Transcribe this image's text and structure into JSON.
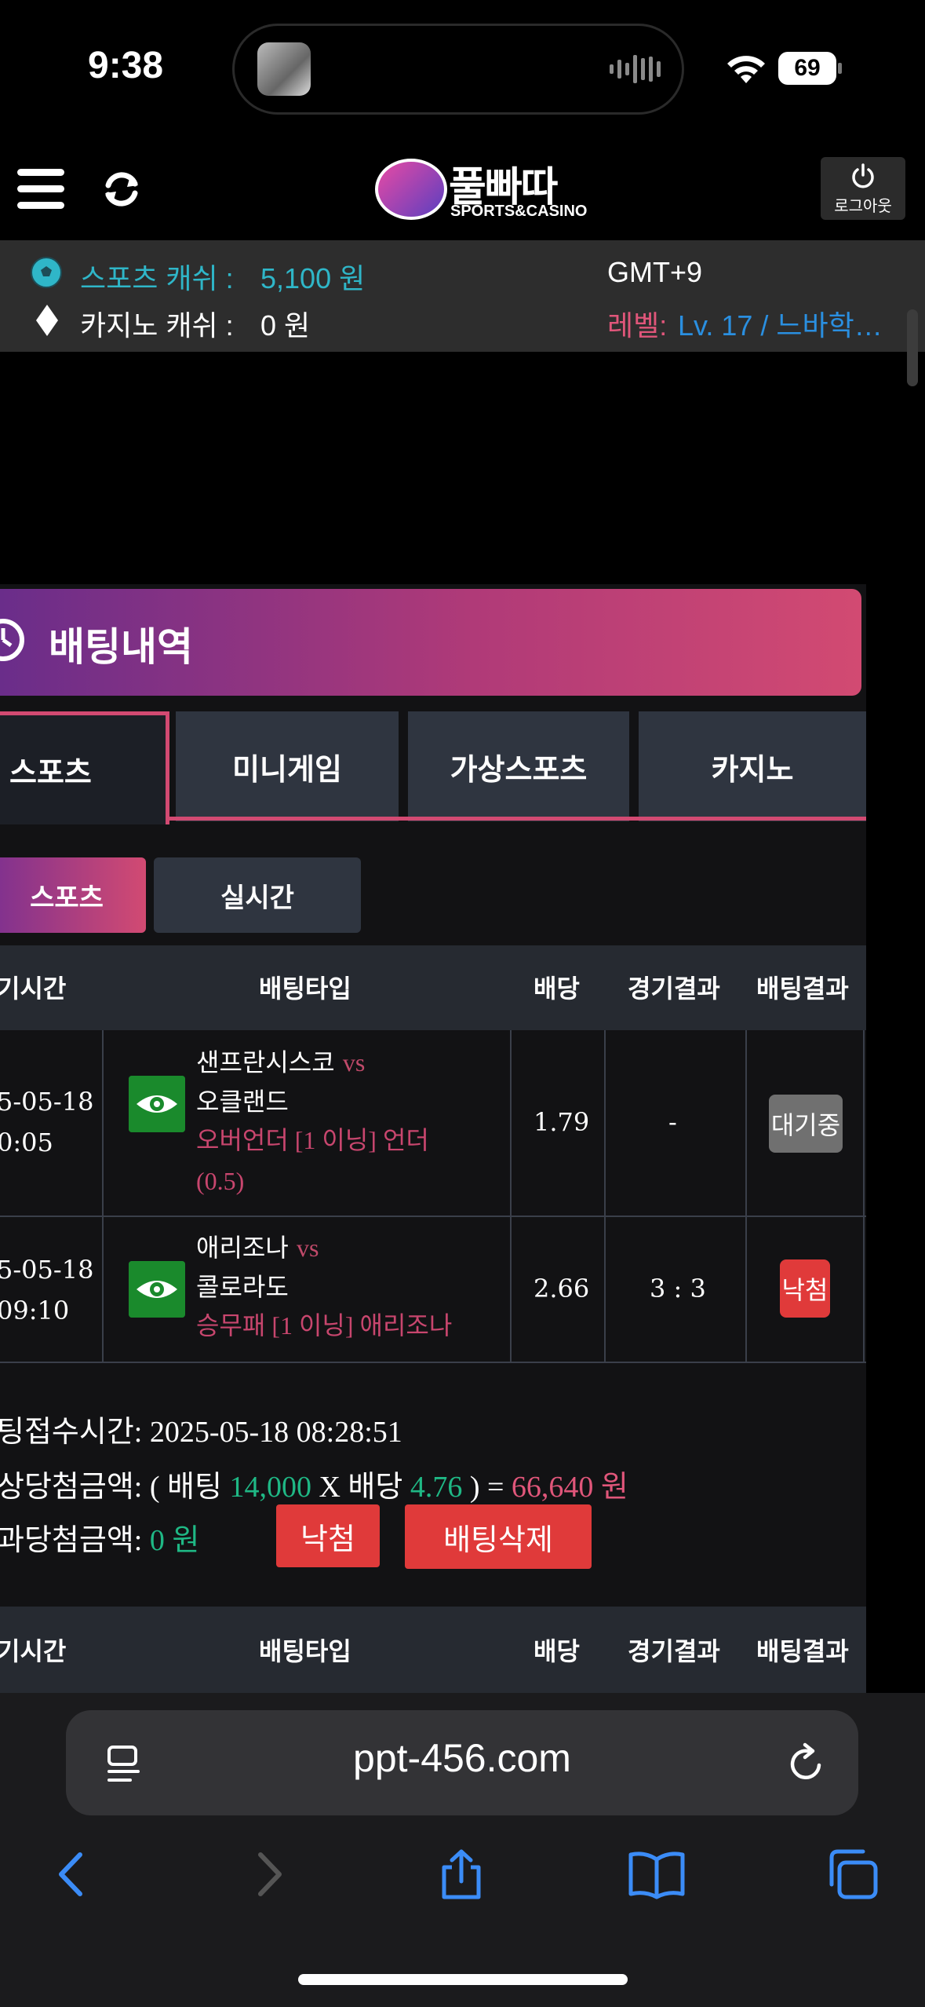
{
  "status": {
    "time": "9:38",
    "battery": "69"
  },
  "header": {
    "logo_text": "풀빠따",
    "logo_sub": "SPORTS&CASINO",
    "logout_label": "로그아웃"
  },
  "info": {
    "sports_cash_label": "스포츠 캐쉬 :",
    "sports_cash_value": "5,100 원",
    "casino_cash_label": "카지노 캐쉬 :",
    "casino_cash_value": "0 원",
    "timezone": "GMT+9",
    "level_label": "레벨:",
    "level_value": "Lv. 17 / 느바학…"
  },
  "section": {
    "title": "배팅내역"
  },
  "tabs": [
    {
      "label": "스포츠"
    },
    {
      "label": "미니게임"
    },
    {
      "label": "가상스포츠"
    },
    {
      "label": "카지노"
    }
  ],
  "subtabs": [
    {
      "label": "스포츠"
    },
    {
      "label": "실시간"
    }
  ],
  "table": {
    "headers": [
      "기시간",
      "배팅타입",
      "배당",
      "경기결과",
      "배팅결과"
    ],
    "rows": [
      {
        "date": "5-05-18",
        "time": "0:05",
        "home": "샌프란시스코",
        "vs": "vs",
        "away": "오클랜드",
        "bet_line1": "오버언더 [1 이닝] 언더",
        "bet_line2": "(0.5)",
        "odds": "1.79",
        "score": "-",
        "result": "대기중"
      },
      {
        "date": "5-05-18",
        "time": "09:10",
        "home": "애리조나",
        "vs": "vs",
        "away": "콜로라도",
        "bet_line1": "승무패 [1 이닝] 애리조나",
        "odds": "2.66",
        "score": "3 : 3",
        "result": "낙첨"
      }
    ]
  },
  "summary": {
    "bet_time_label": "팅접수시간:",
    "bet_time_value": "2025-05-18 08:28:51",
    "expected_label": "상당첨금액: ( 배팅",
    "stake": "14,000",
    "x_odds": "X 배당",
    "total_odds": "4.76",
    "equals": ") =",
    "expected_amount": "66,640 원",
    "actual_label": "과당첨금액:",
    "actual_amount": "0 원",
    "status_button": "낙첨",
    "delete_button": "배팅삭제"
  },
  "table2": {
    "headers": [
      "기시간",
      "배팅타입",
      "배당",
      "경기결과",
      "배팅결과"
    ]
  },
  "browser": {
    "url": "ppt-456.com"
  },
  "colors": {
    "accent_pink": "#d24a72",
    "accent_cyan": "#2fb6c8",
    "green": "#1fb885",
    "red": "#e03a3a"
  }
}
